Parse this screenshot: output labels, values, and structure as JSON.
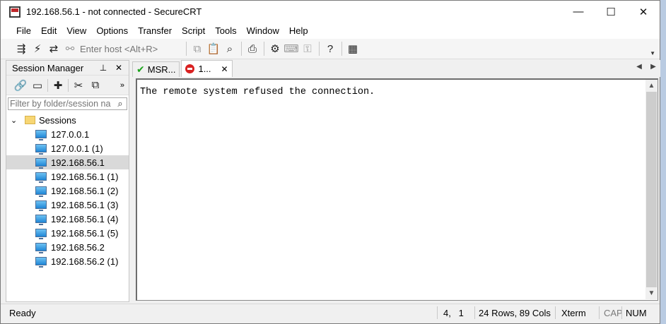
{
  "window": {
    "title": "192.168.56.1 - not connected - SecureCRT",
    "controls": {
      "minimize": "—",
      "maximize": "☐",
      "close": "✕"
    }
  },
  "menu": [
    "File",
    "Edit",
    "View",
    "Options",
    "Transfer",
    "Script",
    "Tools",
    "Window",
    "Help"
  ],
  "toolbar": {
    "host_placeholder": "Enter host <Alt+R>",
    "icons": [
      "connect-icon",
      "quick-connect-icon",
      "reconnect-icon",
      "disconnect-icon",
      "copy-icon",
      "paste-icon",
      "find-icon",
      "print-icon",
      "settings-icon",
      "keymap-icon",
      "keygen-icon",
      "help-icon",
      "sftp-icon"
    ]
  },
  "session_manager": {
    "title": "Session Manager",
    "filter_placeholder": "Filter by folder/session na",
    "root_folder": "Sessions",
    "sessions": [
      "127.0.0.1",
      "127.0.0.1 (1)",
      "192.168.56.1",
      "192.168.56.1 (1)",
      "192.168.56.1 (2)",
      "192.168.56.1 (3)",
      "192.168.56.1 (4)",
      "192.168.56.1 (5)",
      "192.168.56.2",
      "192.168.56.2 (1)"
    ],
    "selected": "192.168.56.1"
  },
  "tabs": [
    {
      "label": "MSR...",
      "status": "connected"
    },
    {
      "label": "1...",
      "status": "disconnected",
      "active": true
    }
  ],
  "terminal": {
    "text": "The remote system refused the connection."
  },
  "status": {
    "state": "Ready",
    "cursor": "4,   1",
    "size": "24 Rows, 89 Cols",
    "emulation": "Xterm",
    "cap": "CAP",
    "num": "NUM"
  }
}
